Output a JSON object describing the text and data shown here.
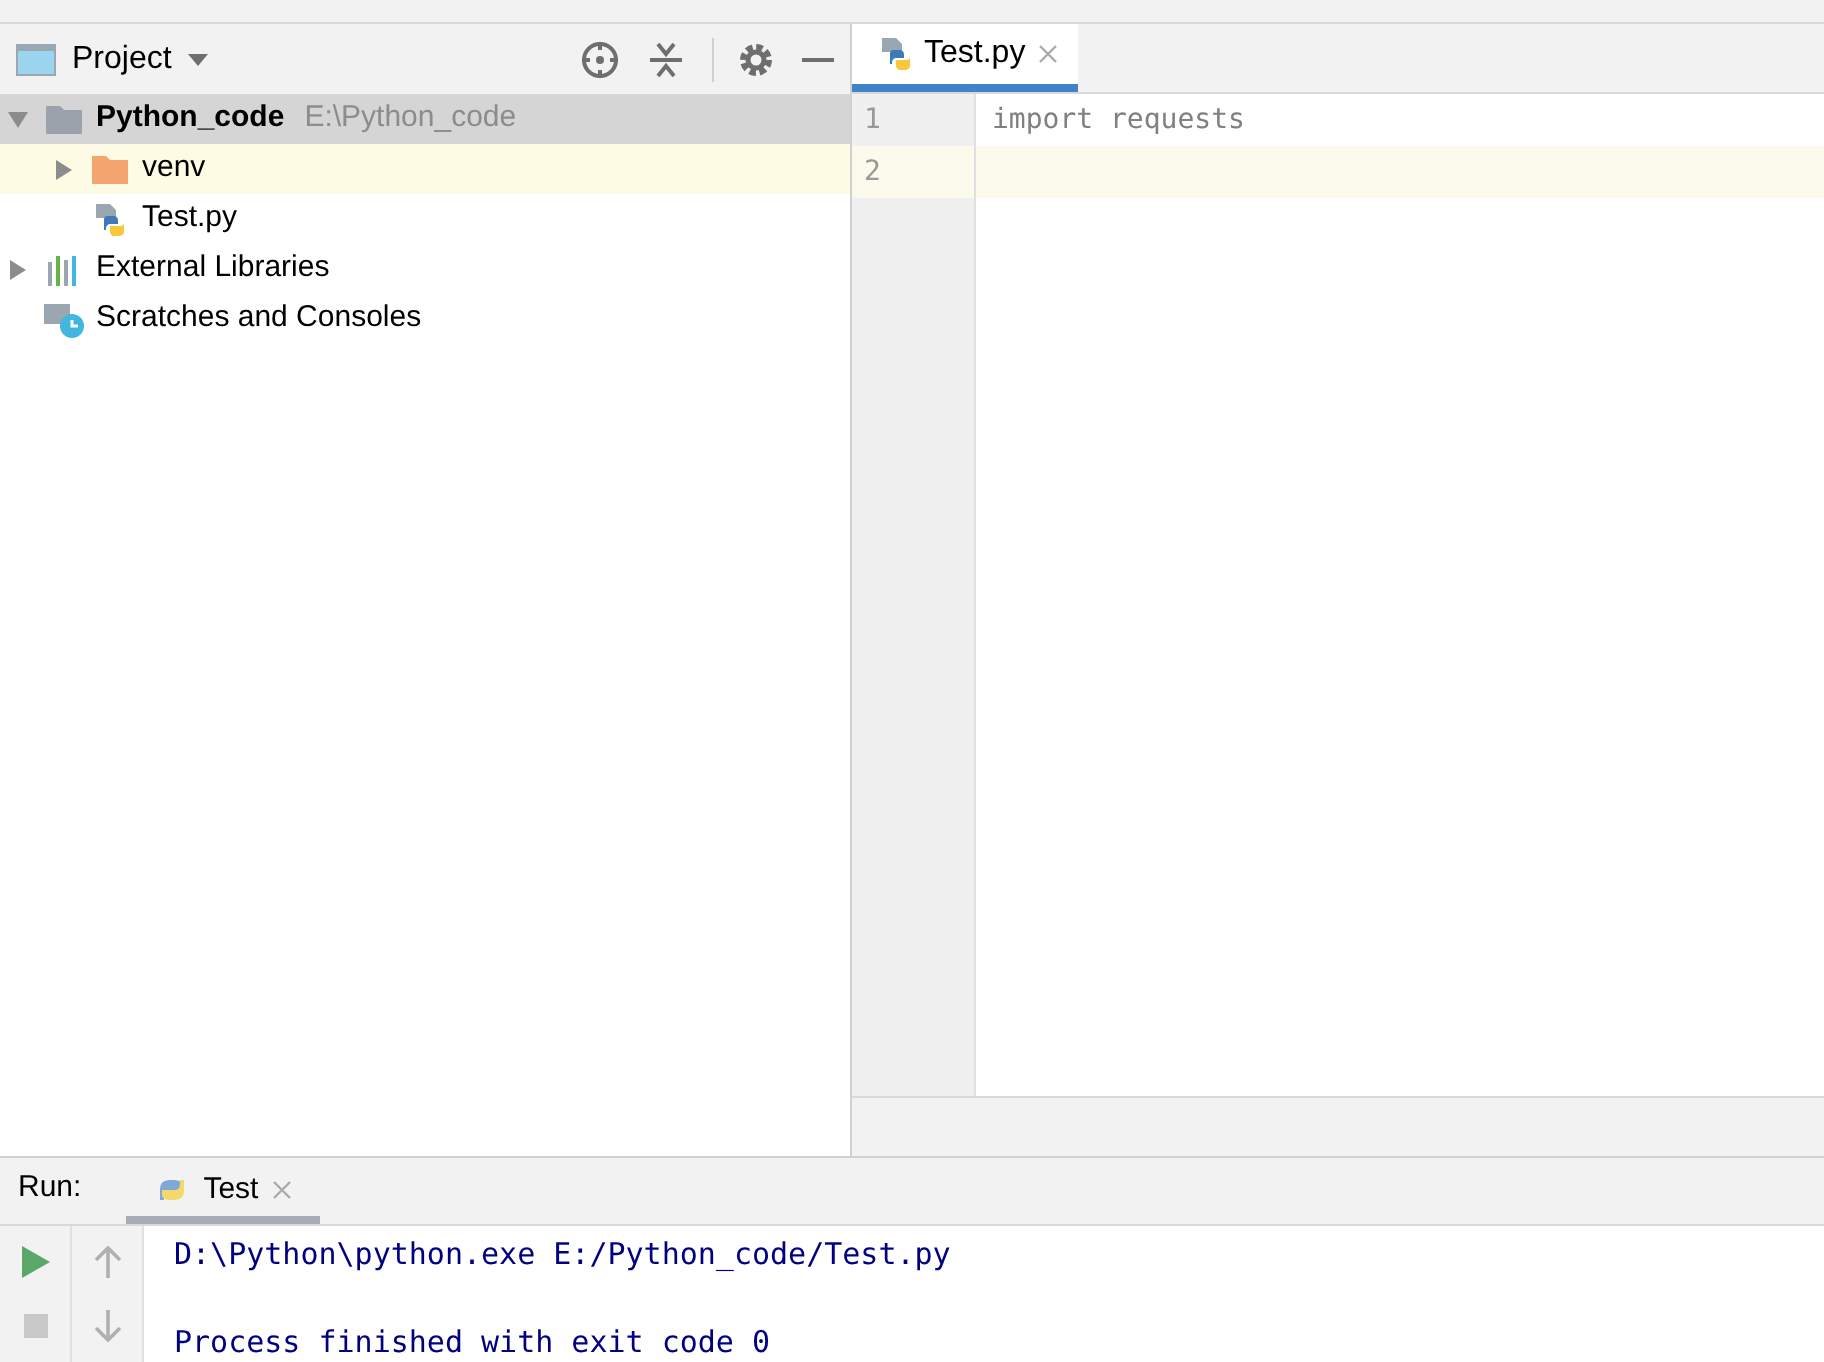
{
  "project_panel": {
    "title": "Project",
    "tree": [
      {
        "kind": "root",
        "label": "Python_code",
        "path": "E:\\Python_code",
        "expanded": true,
        "selected": true,
        "highlighted": false,
        "children": [
          {
            "kind": "folder",
            "label": "venv",
            "expanded": false,
            "selected": false,
            "highlighted": true
          },
          {
            "kind": "python-file",
            "label": "Test.py",
            "selected": false,
            "highlighted": false
          }
        ]
      },
      {
        "kind": "libraries",
        "label": "External Libraries",
        "expanded": false,
        "selected": false,
        "highlighted": false
      },
      {
        "kind": "scratches",
        "label": "Scratches and Consoles",
        "selected": false,
        "highlighted": false
      }
    ]
  },
  "editor": {
    "tabs": [
      {
        "label": "Test.py",
        "selected": true
      }
    ],
    "lines": [
      {
        "number": "1",
        "code": "import requests",
        "current": false
      },
      {
        "number": "2",
        "current": true
      }
    ]
  },
  "run_panel": {
    "label": "Run:",
    "tabs": [
      {
        "label": "Test",
        "selected": true
      }
    ],
    "output": {
      "command": "D:\\Python\\python.exe E:/Python_code/Test.py",
      "exit_message": "Process finished with exit code 0"
    }
  }
}
